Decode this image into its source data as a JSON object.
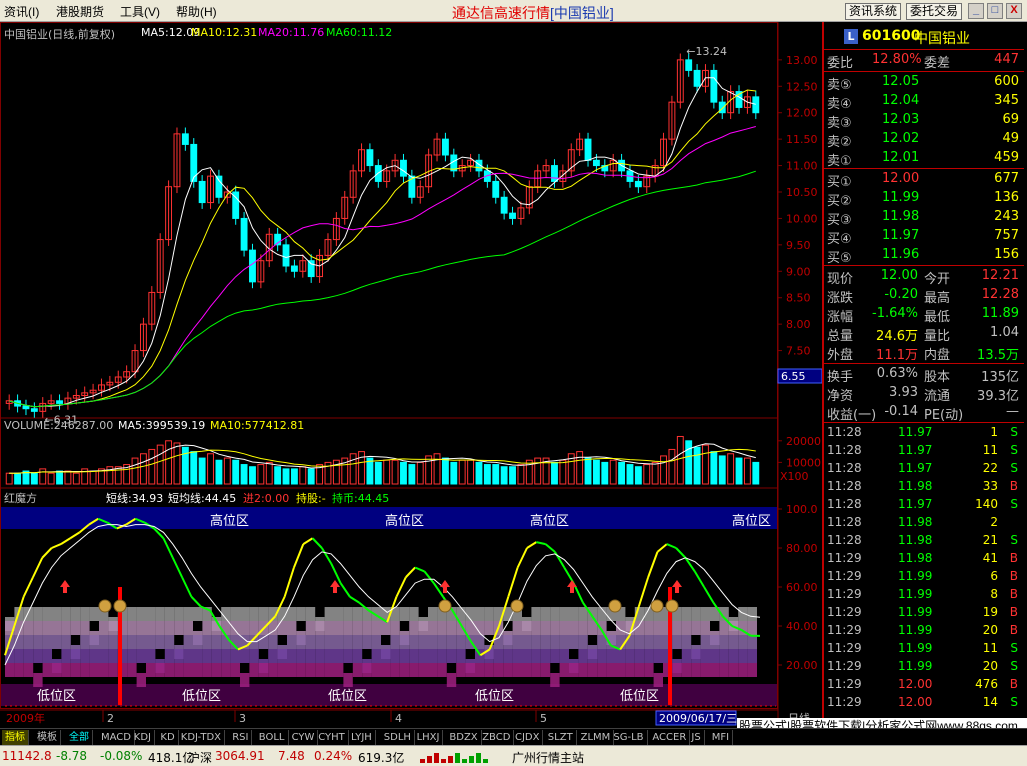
{
  "menu": [
    "资讯(I)",
    "港股期货",
    "工具(V)",
    "帮助(H)"
  ],
  "app_title": "通达信高速行情",
  "app_title_stock": "[中国铝业]",
  "top_buttons": [
    "资讯系统",
    "委托交易"
  ],
  "window_buttons": [
    "_",
    "□",
    "X"
  ],
  "colors": {
    "up": "#ff3232",
    "down": "#00ffff",
    "ma5": "#ffffff",
    "ma10": "#ffff00",
    "ma20": "#ff00ff",
    "ma60": "#00ff00",
    "grid": "#800000",
    "zone_band": "#000080"
  },
  "main_header": {
    "title": "中国铝业(日线,前复权)",
    "ma5": "MA5:12.09",
    "ma10": "MA10:12.31",
    "ma20": "MA20:11.76",
    "ma60": "MA60:11.12"
  },
  "volume_header": {
    "volume": "VOLUME:246287.00",
    "ma5": "MA5:399539.19",
    "ma10": "MA10:577412.81"
  },
  "indicator_header": {
    "name": "红魔方",
    "short": "短线:34.93",
    "short_avg": "短均线:44.45",
    "advance": "进2:0.00",
    "hold": "持股:-",
    "hold_cash": "持币:44.45"
  },
  "chart_data": [
    {
      "type": "candlestick",
      "title": "中国铝业(日线,前复权)",
      "ylim": [
        6.3,
        13.3
      ],
      "y_ticks": [
        13.0,
        12.5,
        12.0,
        11.5,
        11.0,
        10.5,
        10.0,
        9.5,
        9.0,
        8.5,
        8.0,
        7.5,
        7.0
      ],
      "high_label": "13.24",
      "low_label": "6.31",
      "current_marker": "6.55",
      "close": [
        6.55,
        6.45,
        6.4,
        6.35,
        6.5,
        6.55,
        6.5,
        6.6,
        6.65,
        6.7,
        6.75,
        6.85,
        6.9,
        7.0,
        7.1,
        7.5,
        8.0,
        8.6,
        9.6,
        10.6,
        11.6,
        11.4,
        10.7,
        10.3,
        10.8,
        10.4,
        10.5,
        10.0,
        9.4,
        8.8,
        9.2,
        9.7,
        9.5,
        9.1,
        9.0,
        9.2,
        8.9,
        9.3,
        9.6,
        10.0,
        10.4,
        10.9,
        11.3,
        11.0,
        10.7,
        10.9,
        11.1,
        10.8,
        10.4,
        10.6,
        11.2,
        11.5,
        11.2,
        10.9,
        11.0,
        11.1,
        10.9,
        10.7,
        10.4,
        10.1,
        10.0,
        10.2,
        10.6,
        10.9,
        11.0,
        10.7,
        10.9,
        11.3,
        11.5,
        11.1,
        11.0,
        10.9,
        11.1,
        10.9,
        10.7,
        10.6,
        10.8,
        11.0,
        11.5,
        12.2,
        13.0,
        12.8,
        12.5,
        12.8,
        12.2,
        12.0,
        12.4,
        12.1,
        12.3,
        12.0
      ],
      "series": [
        {
          "name": "MA5",
          "value": 12.09
        },
        {
          "name": "MA10",
          "value": 12.31
        },
        {
          "name": "MA20",
          "value": 11.76
        },
        {
          "name": "MA60",
          "value": 11.12
        }
      ]
    },
    {
      "type": "bar",
      "title": "VOLUME",
      "y_ticks": [
        20000,
        10000
      ],
      "unit": "X100",
      "values": [
        5,
        5,
        6,
        5,
        7,
        5,
        6,
        6,
        5,
        7,
        6,
        7,
        8,
        8,
        9,
        12,
        14,
        16,
        18,
        20,
        19,
        17,
        15,
        12,
        14,
        11,
        12,
        11,
        9,
        8,
        9,
        10,
        8,
        7,
        7,
        8,
        7,
        9,
        10,
        11,
        12,
        14,
        15,
        12,
        10,
        11,
        11,
        10,
        9,
        10,
        13,
        14,
        12,
        10,
        11,
        11,
        10,
        9,
        9,
        8,
        8,
        9,
        11,
        12,
        12,
        10,
        11,
        14,
        15,
        12,
        11,
        10,
        11,
        10,
        9,
        8,
        9,
        10,
        13,
        16,
        22,
        20,
        17,
        18,
        15,
        13,
        14,
        12,
        12,
        10
      ]
    },
    {
      "type": "line",
      "title": "红魔方",
      "ylim": [
        0,
        100
      ],
      "y_ticks": [
        100.0,
        80.0,
        60.0,
        40.0,
        20.0
      ],
      "zone_labels_top": [
        "高位区",
        "高位区",
        "高位区",
        "高位区"
      ],
      "zone_labels_bottom": [
        "低位区",
        "低位区",
        "低位区",
        "低位区",
        "低位区"
      ],
      "series": [
        {
          "name": "短线",
          "last": 34.93,
          "values": [
            25,
            40,
            55,
            65,
            75,
            80,
            82,
            85,
            88,
            92,
            95,
            93,
            90,
            92,
            95,
            93,
            90,
            85,
            75,
            65,
            55,
            50,
            48,
            40,
            33,
            28,
            30,
            35,
            40,
            45,
            55,
            70,
            82,
            85,
            80,
            72,
            62,
            55,
            52,
            48,
            45,
            42,
            55,
            65,
            70,
            68,
            62,
            55,
            48,
            40,
            32,
            25,
            28,
            40,
            55,
            70,
            80,
            83,
            82,
            78,
            70,
            62,
            52,
            45,
            38,
            30,
            28,
            35,
            50,
            65,
            78,
            82,
            80,
            75,
            68,
            60,
            52,
            45,
            40,
            38,
            35,
            34.93
          ]
        },
        {
          "name": "短均线",
          "last": 44.45,
          "values": [
            20,
            30,
            42,
            52,
            62,
            70,
            76,
            80,
            84,
            88,
            91,
            92,
            92,
            91,
            92,
            92,
            91,
            88,
            82,
            75,
            67,
            60,
            54,
            48,
            42,
            36,
            32,
            32,
            35,
            38,
            45,
            55,
            66,
            74,
            78,
            77,
            72,
            66,
            60,
            55,
            51,
            47,
            50,
            56,
            62,
            64,
            64,
            60,
            55,
            49,
            43,
            36,
            32,
            34,
            42,
            52,
            63,
            71,
            76,
            77,
            74,
            69,
            62,
            55,
            49,
            43,
            38,
            36,
            40,
            48,
            58,
            67,
            73,
            75,
            73,
            69,
            63,
            57,
            51,
            47,
            45,
            44.45
          ]
        }
      ]
    }
  ],
  "x_axis": {
    "year": "2009年",
    "months": [
      "2",
      "3",
      "4",
      "5"
    ],
    "cursor_date": "2009/06/17/三",
    "right_label": "日线"
  },
  "quote": {
    "code": "601600",
    "name": "中国铝业",
    "logo": "L",
    "rows_top": [
      {
        "label": "委比",
        "value": "12.80%",
        "label2": "委差",
        "value2": "447"
      }
    ],
    "sell": [
      {
        "label": "卖⑤",
        "price": "12.05",
        "vol": "600"
      },
      {
        "label": "卖④",
        "price": "12.04",
        "vol": "345"
      },
      {
        "label": "卖③",
        "price": "12.03",
        "vol": "69"
      },
      {
        "label": "卖②",
        "price": "12.02",
        "vol": "49"
      },
      {
        "label": "卖①",
        "price": "12.01",
        "vol": "459"
      }
    ],
    "buy": [
      {
        "label": "买①",
        "price": "12.00",
        "vol": "677"
      },
      {
        "label": "买②",
        "price": "11.99",
        "vol": "136"
      },
      {
        "label": "买③",
        "price": "11.98",
        "vol": "243"
      },
      {
        "label": "买④",
        "price": "11.97",
        "vol": "757"
      },
      {
        "label": "买⑤",
        "price": "11.96",
        "vol": "156"
      }
    ],
    "stats": [
      {
        "l1": "现价",
        "v1": "12.00",
        "l2": "今开",
        "v2": "12.21"
      },
      {
        "l1": "涨跌",
        "v1": "-0.20",
        "l2": "最高",
        "v2": "12.28"
      },
      {
        "l1": "涨幅",
        "v1": "-1.64%",
        "l2": "最低",
        "v2": "11.89"
      },
      {
        "l1": "总量",
        "v1": "24.6万",
        "l2": "量比",
        "v2": "1.04"
      },
      {
        "l1": "外盘",
        "v1": "11.1万",
        "l2": "内盘",
        "v2": "13.5万"
      }
    ],
    "stats2": [
      {
        "l1": "换手",
        "v1": "0.63%",
        "l2": "股本",
        "v2": "135亿"
      },
      {
        "l1": "净资",
        "v1": "3.93",
        "l2": "流通",
        "v2": "39.3亿"
      },
      {
        "l1": "收益(一)",
        "v1": "-0.14",
        "l2": "PE(动)",
        "v2": "—"
      }
    ],
    "ticks": [
      {
        "t": "11:28",
        "p": "11.97",
        "v": "1",
        "s": "S"
      },
      {
        "t": "11:28",
        "p": "11.97",
        "v": "11",
        "s": "S"
      },
      {
        "t": "11:28",
        "p": "11.97",
        "v": "22",
        "s": "S"
      },
      {
        "t": "11:28",
        "p": "11.98",
        "v": "33",
        "s": "B"
      },
      {
        "t": "11:28",
        "p": "11.97",
        "v": "140",
        "s": "S"
      },
      {
        "t": "11:28",
        "p": "11.98",
        "v": "2",
        "s": ""
      },
      {
        "t": "11:28",
        "p": "11.98",
        "v": "21",
        "s": "S"
      },
      {
        "t": "11:29",
        "p": "11.98",
        "v": "41",
        "s": "B"
      },
      {
        "t": "11:29",
        "p": "11.99",
        "v": "6",
        "s": "B"
      },
      {
        "t": "11:29",
        "p": "11.99",
        "v": "8",
        "s": "B"
      },
      {
        "t": "11:29",
        "p": "11.99",
        "v": "19",
        "s": "B"
      },
      {
        "t": "11:29",
        "p": "11.99",
        "v": "20",
        "s": "B"
      },
      {
        "t": "11:29",
        "p": "11.99",
        "v": "11",
        "s": "S"
      },
      {
        "t": "11:29",
        "p": "11.99",
        "v": "20",
        "s": "S"
      },
      {
        "t": "11:29",
        "p": "12.00",
        "v": "476",
        "s": "B"
      },
      {
        "t": "11:29",
        "p": "12.00",
        "v": "14",
        "s": "S"
      }
    ]
  },
  "toolbar": [
    "指标",
    "模板",
    "全部",
    "MACD",
    "KDJ",
    "KD",
    "KDJ-TDX",
    "RSI",
    "BOLL",
    "CYW",
    "CYHT",
    "LYJH",
    "SDLH",
    "LHXJ",
    "BDZX",
    "ZBCD",
    "CJDX",
    "SLZT",
    "ZLMM",
    "SG-LB",
    "ACCER",
    "JS",
    "MFI"
  ],
  "ad_banner": "股票公式|股票软件下载|分析家公式网www.88gs.com",
  "status": {
    "index1": "11142.8",
    "change1": "-8.78",
    "pct1": "-0.08%",
    "amt1": "418.1亿",
    "name2": "沪深",
    "index2": "3064.91",
    "change2": "7.48",
    "pct2": "0.24%",
    "amt2": "619.3亿",
    "station": "广州行情主站"
  }
}
